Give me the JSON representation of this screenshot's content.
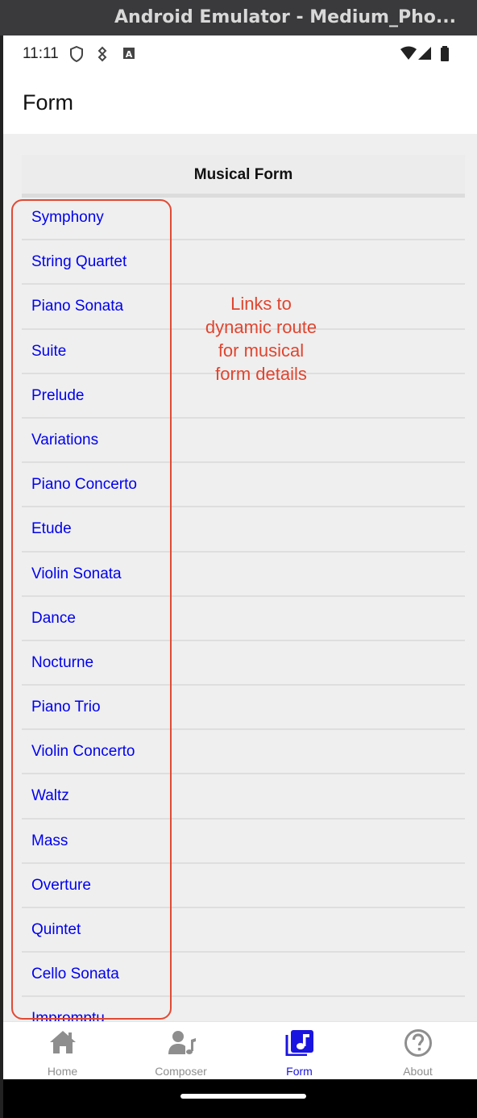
{
  "window": {
    "title": "Android Emulator - Medium_Pho..."
  },
  "status_bar": {
    "time": "11:11"
  },
  "app_bar": {
    "title": "Form"
  },
  "table": {
    "header": "Musical Form",
    "items": [
      "Symphony",
      "String Quartet",
      "Piano Sonata",
      "Suite",
      "Prelude",
      "Variations",
      "Piano Concerto",
      "Etude",
      "Violin Sonata",
      "Dance",
      "Nocturne",
      "Piano Trio",
      "Violin Concerto",
      "Waltz",
      "Mass",
      "Overture",
      "Quintet",
      "Cello Sonata",
      "Impromptu"
    ]
  },
  "annotation": {
    "text": "Links to\ndynamic route\nfor musical\nform details",
    "color": "#e0452f"
  },
  "tabs": [
    {
      "label": "Home",
      "icon": "home-icon",
      "active": false
    },
    {
      "label": "Composer",
      "icon": "composer-icon",
      "active": false
    },
    {
      "label": "Form",
      "icon": "music-note-icon",
      "active": true
    },
    {
      "label": "About",
      "icon": "help-circle-icon",
      "active": false
    }
  ],
  "colors": {
    "link": "#0000ee",
    "active_tab": "#1a14e0",
    "inactive_tab": "#8e8e8e"
  }
}
